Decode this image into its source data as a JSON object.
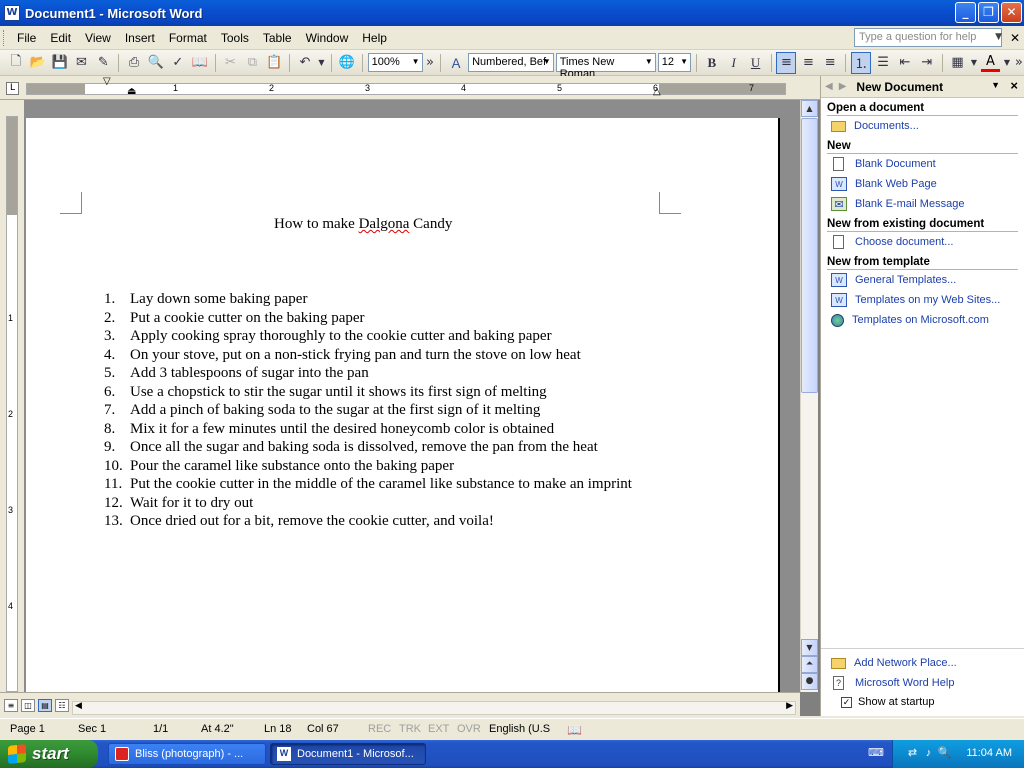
{
  "window": {
    "title": "Document1 - Microsoft Word",
    "app_icon": "W",
    "minimize": "_",
    "restore": "❐",
    "close": "✕"
  },
  "menubar": {
    "items": [
      "File",
      "Edit",
      "View",
      "Insert",
      "Format",
      "Tools",
      "Table",
      "Window",
      "Help"
    ],
    "help_placeholder": "Type a question for help",
    "close": "✕"
  },
  "toolbar": {
    "zoom": "100%",
    "style": "Numbered, Bef",
    "font": "Times New Roman",
    "size": "12",
    "bold": "B",
    "italic": "I",
    "underline": "U",
    "font_color": "A",
    "more": "»"
  },
  "ruler": {
    "h_numbers": [
      "1",
      "2",
      "3",
      "4",
      "5",
      "6",
      "7"
    ],
    "v_numbers": [
      "1",
      "2",
      "3",
      "4"
    ]
  },
  "document": {
    "title_pre": "How to make ",
    "title_misspelled": "Dalgona",
    "title_post": " Candy",
    "steps": [
      {
        "n": "1.",
        "text": "Lay down some baking paper"
      },
      {
        "n": "2.",
        "text": "Put a cookie cutter on the baking paper"
      },
      {
        "n": "3.",
        "text": "Apply cooking spray thoroughly to the cookie cutter and baking paper"
      },
      {
        "n": "4.",
        "text": "On your stove, put on a non-stick frying pan and turn the stove on low heat"
      },
      {
        "n": "5.",
        "text": "Add 3 tablespoons of sugar into the pan"
      },
      {
        "n": "6.",
        "text": "Use a chopstick to stir the sugar until it shows its first sign of melting"
      },
      {
        "n": "7.",
        "text": "Add a pinch of baking soda to the sugar at the first sign of it melting"
      },
      {
        "n": "8.",
        "text": "Mix it for a few minutes until the desired honeycomb color is obtained"
      },
      {
        "n": "9.",
        "text": "Once all the sugar and baking soda is dissolved, remove the pan from the heat"
      },
      {
        "n": "10.",
        "text": "Pour the caramel like substance onto the baking paper"
      },
      {
        "n": "11.",
        "text": "Put the cookie cutter in the middle of the caramel like substance to make an imprint"
      },
      {
        "n": "12.",
        "text": "Wait for it to dry out"
      },
      {
        "n": "13.",
        "text": "Once dried out for a bit, remove the cookie cutter, and voila!"
      }
    ]
  },
  "taskpane": {
    "title": "New Document",
    "sections": {
      "open": "Open a document",
      "new": "New",
      "existing": "New from existing document",
      "template": "New from template"
    },
    "links": {
      "documents": "Documents...",
      "blank_document": "Blank Document",
      "blank_web_page": "Blank Web Page",
      "blank_email": "Blank E-mail Message",
      "choose_document": "Choose document...",
      "general_templates": "General Templates...",
      "web_site_templates": "Templates on my Web Sites...",
      "ms_templates": "Templates on Microsoft.com",
      "add_network_place": "Add Network Place...",
      "word_help": "Microsoft Word Help"
    },
    "show_at_startup": "Show at startup"
  },
  "status": {
    "page": "Page  1",
    "sec": "Sec  1",
    "pages": "1/1",
    "at": "At  4.2\"",
    "ln": "Ln  18",
    "col": "Col  67",
    "rec": "REC",
    "trk": "TRK",
    "ext": "EXT",
    "ovr": "OVR",
    "lang": "English (U.S"
  },
  "taskbar": {
    "start": "start",
    "tasks": [
      "Bliss (photograph) - ...",
      "Document1 - Microsof..."
    ],
    "clock": "11:04 AM"
  },
  "colors": {
    "title_bar": "#0a4fcf",
    "link": "#1c3faa",
    "taskbar": "#2456c7",
    "start_green": "#2f8a2f"
  }
}
